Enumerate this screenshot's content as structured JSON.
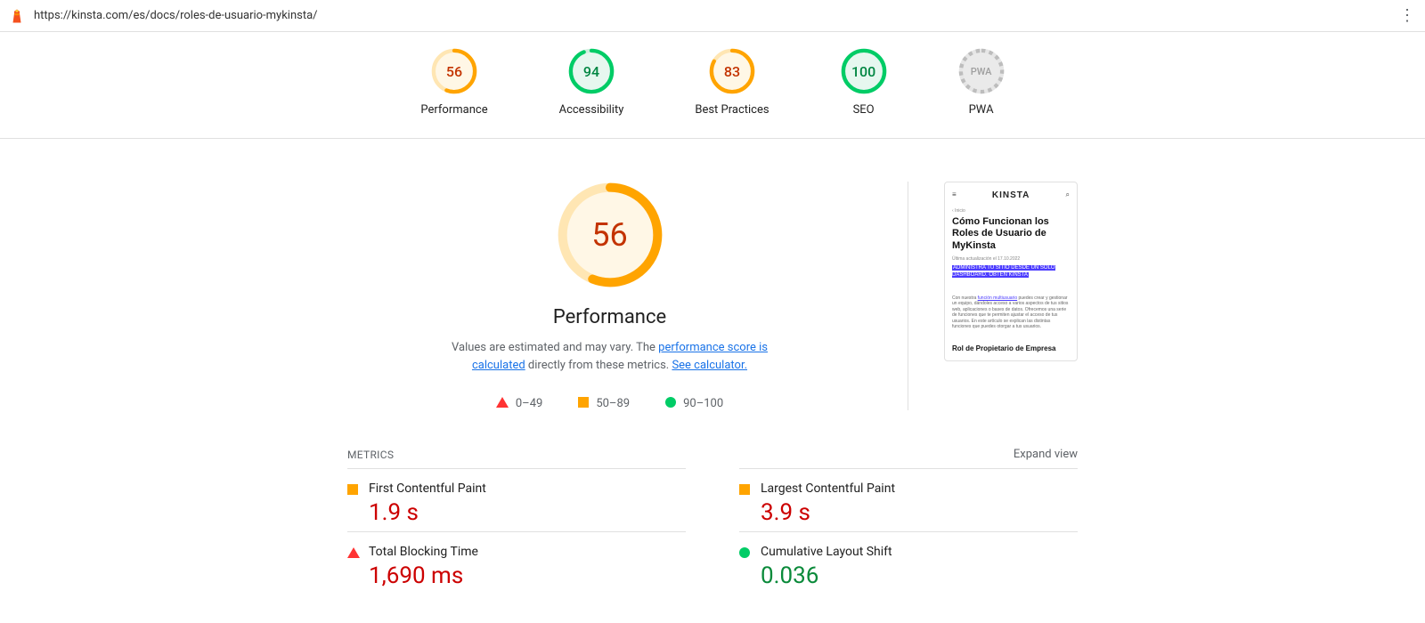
{
  "url": "https://kinsta.com/es/docs/roles-de-usuario-mykinsta/",
  "gauges": [
    {
      "label": "Performance",
      "score": "56",
      "pct": 56,
      "cls": "orange"
    },
    {
      "label": "Accessibility",
      "score": "94",
      "pct": 94,
      "cls": "green"
    },
    {
      "label": "Best Practices",
      "score": "83",
      "pct": 83,
      "cls": "orange"
    },
    {
      "label": "SEO",
      "score": "100",
      "pct": 100,
      "cls": "green"
    },
    {
      "label": "PWA",
      "score": "PWA",
      "pct": 0,
      "cls": "grey"
    }
  ],
  "hero": {
    "score": "56",
    "pct": 56,
    "title": "Performance",
    "desc_pre": "Values are estimated and may vary. The ",
    "link1": "performance score is calculated",
    "desc_mid": " directly from these metrics. ",
    "link2": "See calculator."
  },
  "legend": [
    {
      "range": "0–49"
    },
    {
      "range": "50–89"
    },
    {
      "range": "90–100"
    }
  ],
  "thumb": {
    "brand": "KINSTA",
    "crumb": "‹ Inicio",
    "title": "Cómo Funcionan los Roles de Usuario de MyKinsta",
    "date": "Última actualización el 17.10.2022",
    "highlight": "ADMINISTRA TU SITIO DESDE UN SOLO DASHBOARD. OBTÉN KINSTA",
    "body_pre": "Con nuestra ",
    "body_link": "función multiusuario",
    "body_post": " puedes crear y gestionar un equipo, dándoles acceso a varios aspectos de tus sitios web, aplicaciones o bases de datos. Ofrecemos una serie de funciones que te permiten ajustar el acceso de tus usuarios. En este artículo se explican las distintas funciones que puedes otorgar a tus usuarios.",
    "h2": "Rol de Propietario de Empresa"
  },
  "metrics_label": "METRICS",
  "expand_label": "Expand view",
  "metrics": [
    {
      "name": "First Contentful Paint",
      "value": "1.9 s",
      "mk": "sq",
      "valcls": "red"
    },
    {
      "name": "Largest Contentful Paint",
      "value": "3.9 s",
      "mk": "sq",
      "valcls": "red"
    },
    {
      "name": "Total Blocking Time",
      "value": "1,690 ms",
      "mk": "tri",
      "valcls": "red"
    },
    {
      "name": "Cumulative Layout Shift",
      "value": "0.036",
      "mk": "ci",
      "valcls": "green"
    }
  ],
  "chart_data": [
    {
      "type": "pie",
      "title": "Performance",
      "values": [
        56,
        44
      ],
      "categories": [
        "score",
        "rest"
      ],
      "color": "#ffa400"
    },
    {
      "type": "pie",
      "title": "Accessibility",
      "values": [
        94,
        6
      ],
      "categories": [
        "score",
        "rest"
      ],
      "color": "#0c6"
    },
    {
      "type": "pie",
      "title": "Best Practices",
      "values": [
        83,
        17
      ],
      "categories": [
        "score",
        "rest"
      ],
      "color": "#ffa400"
    },
    {
      "type": "pie",
      "title": "SEO",
      "values": [
        100,
        0
      ],
      "categories": [
        "score",
        "rest"
      ],
      "color": "#0c6"
    },
    {
      "type": "pie",
      "title": "PWA",
      "values": [
        0,
        100
      ],
      "categories": [
        "score",
        "rest"
      ],
      "color": "#bdbdbd"
    }
  ]
}
